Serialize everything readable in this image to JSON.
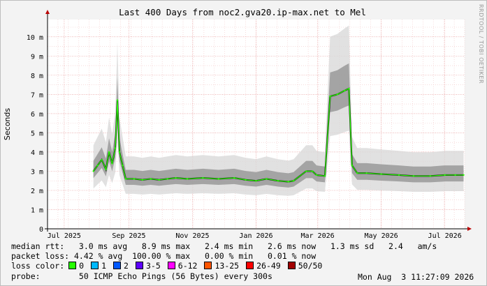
{
  "chart_data": {
    "type": "line",
    "title": "Last 400 Days from noc2.gva20.ip-max.net to Mel",
    "ylabel": "Seconds",
    "ylim": [
      0,
      10.9
    ],
    "yticks": [
      0,
      1,
      2,
      3,
      4,
      5,
      6,
      7,
      8,
      9,
      10
    ],
    "ytick_labels": [
      "0",
      "1 m",
      "2 m",
      "3 m",
      "4 m",
      "5 m",
      "6 m",
      "7 m",
      "8 m",
      "9 m",
      "10 m"
    ],
    "xlim": [
      "2025-06-29",
      "2026-08-03"
    ],
    "xticks": [
      "2025-07-15",
      "2025-09-15",
      "2025-11-15",
      "2026-01-15",
      "2026-03-15",
      "2026-05-15",
      "2026-07-15"
    ],
    "xtick_labels": [
      "Jul 2025",
      "Sep 2025",
      "Nov 2025",
      "Jan 2026",
      "Mar 2026",
      "May 2026",
      "Jul 2026"
    ],
    "series": [
      {
        "points": [
          [
            "2025-08-12",
            3.0
          ],
          [
            "2025-08-16",
            3.3
          ],
          [
            "2025-08-20",
            3.6
          ],
          [
            "2025-08-24",
            3.1
          ],
          [
            "2025-08-27",
            4.0
          ],
          [
            "2025-08-30",
            3.4
          ],
          [
            "2025-09-02",
            4.2
          ],
          [
            "2025-09-04",
            6.7
          ],
          [
            "2025-09-06",
            4.0
          ],
          [
            "2025-09-09",
            3.3
          ],
          [
            "2025-09-12",
            2.6
          ],
          [
            "2025-09-20",
            2.6
          ],
          [
            "2025-09-28",
            2.55
          ],
          [
            "2025-10-06",
            2.6
          ],
          [
            "2025-10-14",
            2.55
          ],
          [
            "2025-10-22",
            2.6
          ],
          [
            "2025-10-30",
            2.65
          ],
          [
            "2025-11-10",
            2.6
          ],
          [
            "2025-11-25",
            2.65
          ],
          [
            "2025-12-10",
            2.6
          ],
          [
            "2025-12-25",
            2.65
          ],
          [
            "2026-01-05",
            2.55
          ],
          [
            "2026-01-15",
            2.5
          ],
          [
            "2026-01-25",
            2.6
          ],
          [
            "2026-02-05",
            2.5
          ],
          [
            "2026-02-15",
            2.45
          ],
          [
            "2026-02-20",
            2.5
          ],
          [
            "2026-03-04",
            3.0
          ],
          [
            "2026-03-10",
            3.0
          ],
          [
            "2026-03-14",
            2.8
          ],
          [
            "2026-03-22",
            2.75
          ],
          [
            "2026-03-27",
            6.9
          ],
          [
            "2026-04-03",
            7.0
          ],
          [
            "2026-04-10",
            7.2
          ],
          [
            "2026-04-14",
            7.3
          ],
          [
            "2026-04-17",
            3.3
          ],
          [
            "2026-04-22",
            2.9
          ],
          [
            "2026-05-01",
            2.9
          ],
          [
            "2026-05-15",
            2.85
          ],
          [
            "2026-06-01",
            2.8
          ],
          [
            "2026-06-15",
            2.75
          ],
          [
            "2026-07-01",
            2.75
          ],
          [
            "2026-07-15",
            2.8
          ],
          [
            "2026-07-25",
            2.8
          ],
          [
            "2026-08-02",
            2.8
          ]
        ]
      }
    ]
  },
  "legend": {
    "median_line": "median rtt:   3.0 ms avg   8.9 ms max   2.4 ms min   2.6 ms now   1.3 ms sd   2.4   am/s",
    "loss_line": "packet loss: 4.42 % avg  100.00 % max   0.00 % min   0.01 % now",
    "loss_color_label": "loss color:",
    "probe_line": "probe:        50 ICMP Echo Pings (56 Bytes) every 300s",
    "timestamp": "Mon Aug  3 11:27:09 2026",
    "loss_colors": [
      {
        "label": "0",
        "color": "#26ff00"
      },
      {
        "label": "1",
        "color": "#00b8ff"
      },
      {
        "label": "2",
        "color": "#0059ff"
      },
      {
        "label": "3-5",
        "color": "#5e00ff"
      },
      {
        "label": "6-12",
        "color": "#ff00ff"
      },
      {
        "label": "13-25",
        "color": "#ff5500"
      },
      {
        "label": "26-49",
        "color": "#ff0000"
      },
      {
        "label": "50/50",
        "color": "#a10000"
      }
    ]
  },
  "watermark": "RRDTOOL / TOBI OETIKER"
}
